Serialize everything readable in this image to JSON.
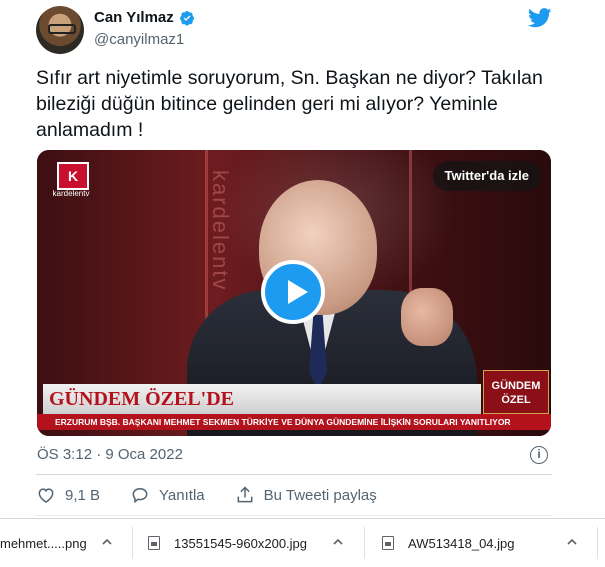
{
  "tweet": {
    "author_name": "Can Yılmaz",
    "handle": "@canyilmaz1",
    "text": "Sıfır art niyetimle soruyorum, Sn. Başkan ne diyor? Takılan bileziği düğün bitince gelinden geri mi alıyor? Yeminle anlamadım !",
    "media": {
      "watch_label": "Twitter'da izle",
      "channel_logo_letter": "K",
      "channel_logo_label": "kardelentv",
      "background_brand": "kardelentv",
      "lower_third_title": "GÜNDEM ÖZEL'DE",
      "lower_third_badge_line1": "GÜNDEM",
      "lower_third_badge_line2": "ÖZEL",
      "ticker_text": "ERZURUM BŞB. BAŞKANI MEHMET SEKMEN TÜRKİYE VE DÜNYA GÜNDEMİNE İLİŞKİN SORULARI YANITLIYOR"
    },
    "timestamp": "ÖS 3:12 · 9 Oca 2022",
    "actions": {
      "like_count": "9,1 B",
      "reply_label": "Yanıtla",
      "share_label": "Bu Tweeti paylaş"
    }
  },
  "downloads": [
    {
      "filename": "mehmet.....png"
    },
    {
      "filename": "13551545-960x200.jpg"
    },
    {
      "filename": "AW513418_04.jpg"
    }
  ],
  "colors": {
    "twitter_blue": "#1d9bf0",
    "text_secondary": "#536471",
    "lower_third_red": "#b3121c"
  }
}
